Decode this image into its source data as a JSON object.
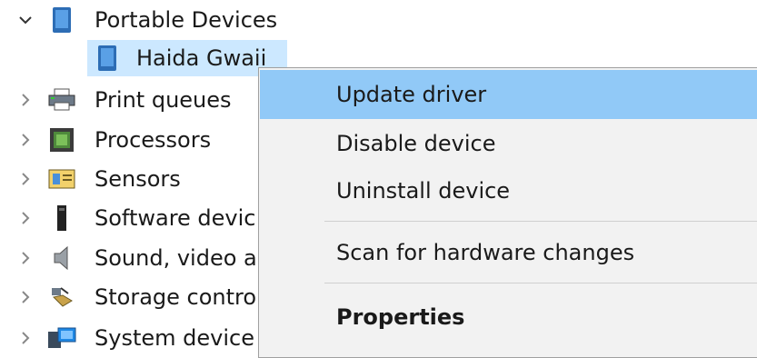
{
  "tree": {
    "expanded_category": "Portable Devices",
    "child_device": "Haida Gwaii",
    "categories": [
      {
        "label": "Print queues"
      },
      {
        "label": "Processors"
      },
      {
        "label": "Sensors"
      },
      {
        "label": "Software devic"
      },
      {
        "label": "Sound, video a"
      },
      {
        "label": "Storage contro"
      },
      {
        "label": "System device"
      }
    ]
  },
  "context_menu": {
    "items": [
      {
        "label": "Update driver"
      },
      {
        "label": "Disable device"
      },
      {
        "label": "Uninstall device"
      },
      {
        "label": "Scan for hardware changes"
      },
      {
        "label": "Properties"
      }
    ]
  },
  "colors": {
    "menu_hover": "#91c9f7",
    "menu_background": "#f2f2f2",
    "selection": "#cce8ff"
  }
}
